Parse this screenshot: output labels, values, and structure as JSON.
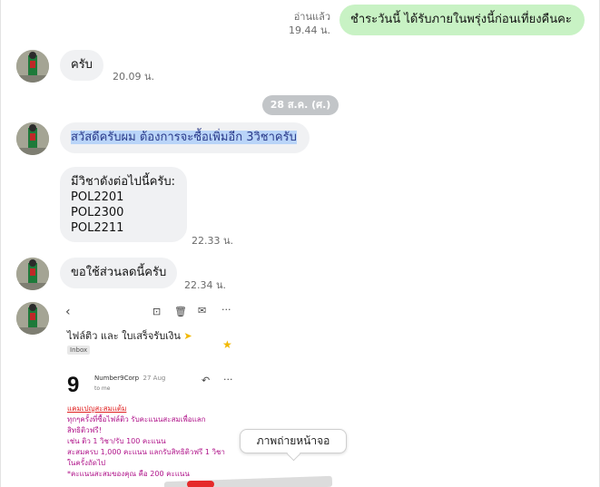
{
  "outgoing": {
    "read_status": "อ่านแล้ว",
    "time": "19.44 น.",
    "text": "ชำระวันนี้ ได้รับภายในพรุ่งนี้ก่อนเที่ยงคืนคะ"
  },
  "messages": [
    {
      "text": "ครับ",
      "time": "20.09 น."
    }
  ],
  "date_divider": "28 ส.ค. (ศ.)",
  "group2": {
    "msg1": "สวัสดีครับผม ต้องการจะซื้อเพิ่มอีก 3วิชาครับ",
    "msg2_lines": [
      "มีวิชาดังต่อไปนี้ครับ:",
      "POL2201",
      "POL2300",
      "POL2211"
    ],
    "time": "22.33 น."
  },
  "group3": {
    "text": "ขอใช้ส่วนลดนี้ครับ",
    "time": "22.34 น."
  },
  "attached_image": {
    "title": "ไฟล์ติว และ ใบเสร็จรับเงิน",
    "inbox_tag": "Inbox",
    "logo": "9",
    "sender": "Number9Corp",
    "date": "27 Aug",
    "to": "to me",
    "body_heading": "แคมเปญสะสมแต้ม",
    "body_lines": [
      "ทุกๆครั้งที่ซื้อไฟล์ติว รับคะแนนสะสมเพื่อแลก",
      "สิทธิติวฟรี!",
      "เช่น ติว 1 วิชา/รับ 100 คะแนน",
      "สะสมครบ 1,000 คะแนน แลกรับสิทธิติวฟรี 1 วิชา",
      "ในครั้งถัดไป",
      "*คะแนนสะสมของคุณ คือ 200 คะแนน"
    ]
  },
  "tooltip": "ภาพถ่ายหน้าจอ",
  "icons": {
    "back": "back-arrow-icon",
    "archive": "archive-icon",
    "delete": "trash-icon",
    "mail": "mail-icon",
    "more": "more-icon",
    "star": "star-icon",
    "reply": "reply-icon",
    "label": "label-arrow-icon"
  },
  "colors": {
    "outgoing_bubble": "#c8f2c4",
    "incoming_bubble": "#f0f1f3",
    "date_pill": "#c2c5c8",
    "selection_highlight": "#b9d4f8"
  }
}
